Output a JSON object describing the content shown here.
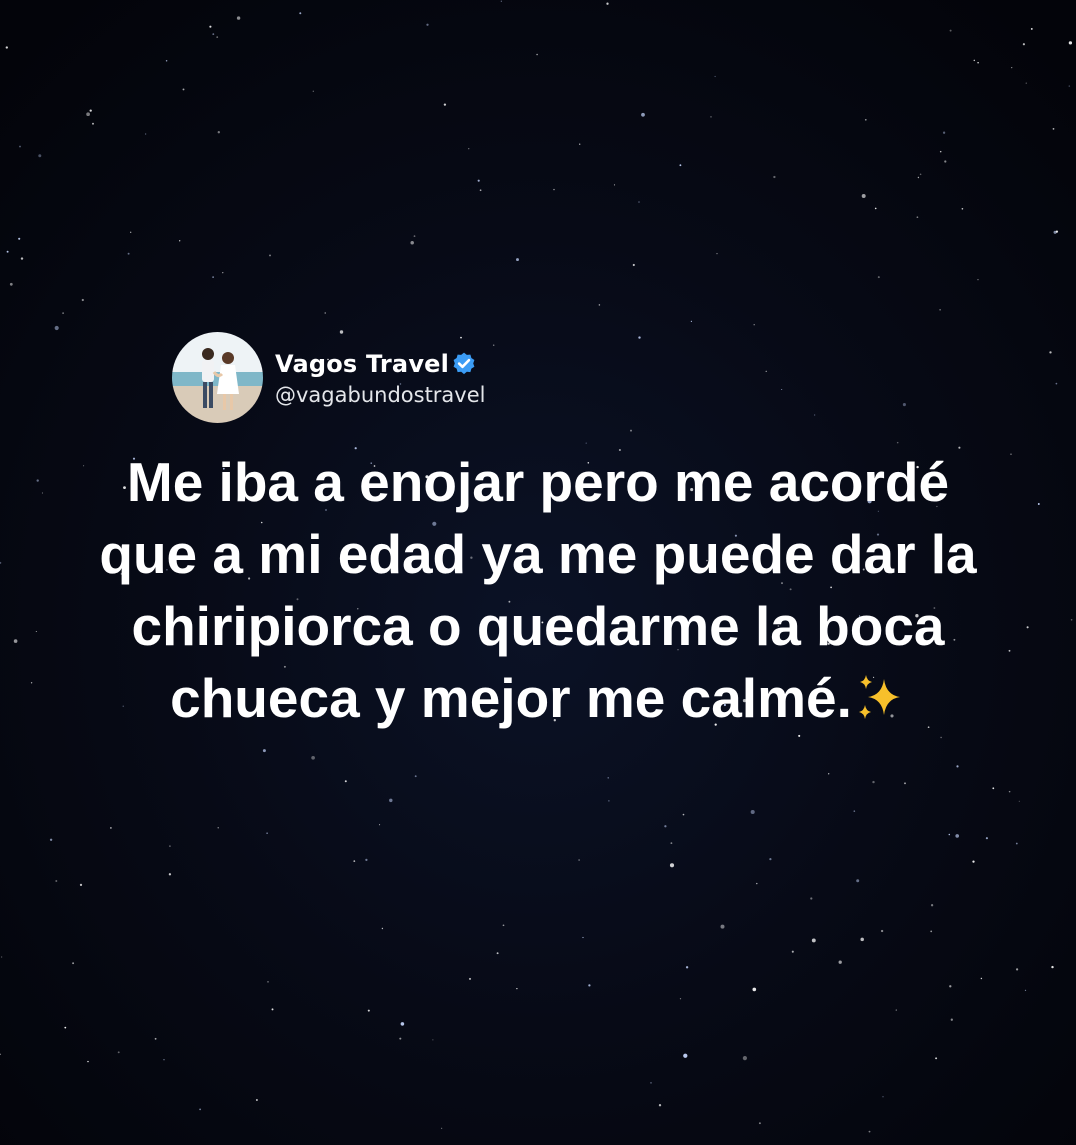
{
  "post": {
    "author": {
      "display_name": "Vagos Travel",
      "handle": "@vagabundostravel",
      "verified": true,
      "verified_badge_color": "#3b9cf5",
      "avatar_icon": "couple-on-beach-photo"
    },
    "text_lines": [
      "Me iba a enojar pero me acordé",
      "que a mi edad ya me puede dar la",
      "chiripiorca o quedarme la boca",
      "chueca y mejor me calmé."
    ],
    "emoji": "sparkles-icon"
  },
  "colors": {
    "background": "#05070f",
    "text": "#ffffff",
    "sparkle": "#f7c02b"
  }
}
